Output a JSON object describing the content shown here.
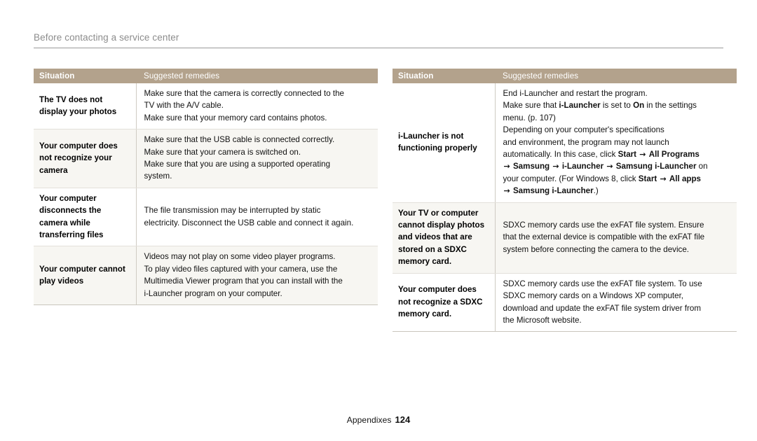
{
  "header": {
    "title": "Before contacting a service center"
  },
  "tables": [
    {
      "id": "left",
      "columns": [
        "Situation",
        "Suggested remedies"
      ],
      "rows": [
        {
          "situation": "The TV does not display your photos",
          "remedy": "Make sure that the camera is correctly connected to the TV with the A/V cable.\nMake sure that your memory card contains photos.",
          "shaded": false
        },
        {
          "situation": "Your computer does not recognize your camera",
          "remedy": "Make sure that the USB cable is connected correctly.\nMake sure that your camera is switched on.\nMake sure that you are using a supported operating system.",
          "shaded": true
        },
        {
          "situation": "Your computer disconnects the camera while transferring files",
          "remedy": "The file transmission may be interrupted by static electricity. Disconnect the USB cable and connect it again.",
          "shaded": false
        },
        {
          "situation": "Your computer cannot play videos",
          "remedy": "Videos may not play on some video player programs.\nTo play video files captured with your camera, use the Multimedia Viewer program that you can install with the i-Launcher program on your computer.",
          "shaded": true
        }
      ]
    },
    {
      "id": "right",
      "columns": [
        "Situation",
        "Suggested remedies"
      ],
      "rows": [
        {
          "situation": "i-Launcher is not functioning properly",
          "remedy": "End i-Launcher and restart the program.\nMake sure that i-Launcher is set to On in the settings menu. (p. 107)\nDepending on your computer's specifications and environment, the program may not launch automatically. In this case, click Start → All Programs → Samsung → i-Launcher → Samsung i-Launcher on your computer. (For Windows 8, click Start → All apps → Samsung i-Launcher.)",
          "shaded": false
        },
        {
          "situation": "Your TV or computer cannot display photos and videos that are stored on a SDXC memory card.",
          "remedy": "SDXC memory cards use the exFAT file system. Ensure that the external device is compatible with the exFAT file system before connecting the camera to the device.",
          "shaded": true
        },
        {
          "situation": "Your computer does not recognize a SDXC memory card.",
          "remedy": "SDXC memory cards use the exFAT file system. To use SDXC memory cards on a Windows XP computer, download and update the exFAT file system driver from the Microsoft website.",
          "shaded": false
        }
      ]
    }
  ],
  "footer": {
    "section": "Appendixes",
    "page_number": "124"
  },
  "colors": {
    "header_band": "#b3a28c",
    "shaded_row": "#f7f6f2",
    "rule": "#9a9a9a"
  }
}
